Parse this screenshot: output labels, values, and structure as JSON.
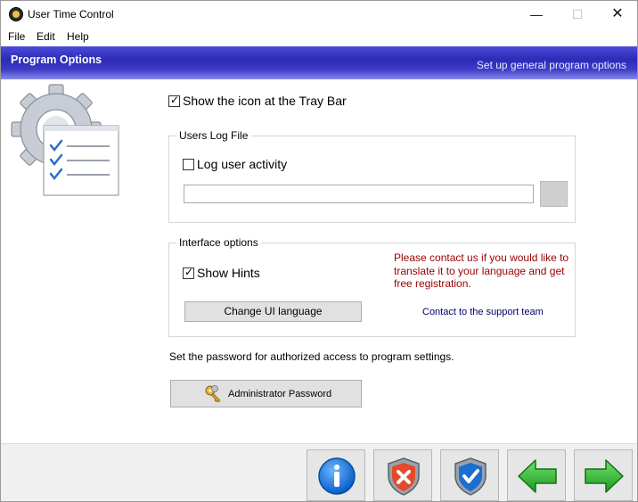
{
  "window": {
    "title": "User Time Control",
    "controls": {
      "minimize": "—",
      "maximize": "☐",
      "close": "✕"
    }
  },
  "menu": {
    "items": [
      "File",
      "Edit",
      "Help"
    ]
  },
  "banner": {
    "title": "Program Options",
    "subtitle": "Set up general program options",
    "color": "#2b2bb8"
  },
  "options": {
    "tray_icon": {
      "label": "Show the icon at the Tray Bar",
      "checked": true
    }
  },
  "log_group": {
    "title": "Users Log File",
    "log_activity": {
      "label": "Log user activity",
      "checked": false
    },
    "path_value": ""
  },
  "interface_group": {
    "title": "Interface options",
    "show_hints": {
      "label": "Show Hints",
      "checked": true
    },
    "change_language_label": "Change UI language",
    "contact_text": "Please contact us if you would like to translate it to your language and get free registration.",
    "contact_color": "#990000",
    "support_link": "Contact to the support team"
  },
  "password": {
    "description": "Set the password for authorized access to program settings.",
    "button_label": "Administrator Password",
    "button_icon": "key-icon"
  },
  "bottom_buttons": [
    {
      "name": "info-button",
      "icon": "info-icon"
    },
    {
      "name": "cancel-button",
      "icon": "shield-x-icon"
    },
    {
      "name": "apply-button",
      "icon": "shield-check-icon"
    },
    {
      "name": "back-button",
      "icon": "arrow-left-icon"
    },
    {
      "name": "next-button",
      "icon": "arrow-right-icon"
    }
  ]
}
